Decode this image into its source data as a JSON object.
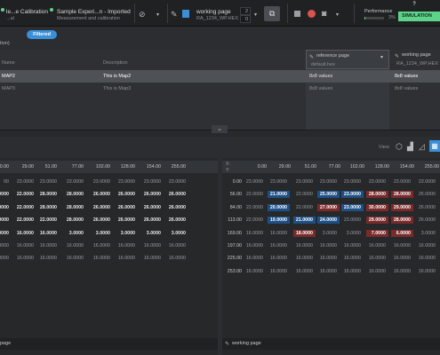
{
  "toolbar": {
    "project_title": "le...e Calibration",
    "project_sub": "...al",
    "experiment_title": "Sample Experi...n - Imported",
    "experiment_sub": "Measurement and calibration",
    "page_title": "working page",
    "page_sub": "RA_1234_WP.HEX",
    "stepper_top": "2",
    "stepper_bottom": "0",
    "performance_label": "Performance",
    "performance_value": "3%",
    "performance_fraction": 0.03,
    "mode_label": "SIMULATION",
    "help": "?"
  },
  "filter": {
    "chip": "Filtered",
    "truncated_label": "tion)"
  },
  "table": {
    "col_name": "Name",
    "col_description": "Description",
    "rows": [
      {
        "name": "MAP2",
        "description": "This is Map2",
        "ref": "8x8 values",
        "work": "8x8 values"
      },
      {
        "name": "MAP3",
        "description": "This is Map3",
        "ref": "8x8 values",
        "work": "8x8 values"
      }
    ]
  },
  "ref_column": {
    "label": "reference page",
    "file": "default.hex"
  },
  "work_column": {
    "label": "working page",
    "file": "RA_1234_WP.HEX"
  },
  "view": {
    "label": "View"
  },
  "left_map": {
    "x_headers": [
      "0.00",
      "29.00",
      "51.00",
      "77.00",
      "102.00",
      "128.00",
      "154.00",
      "255.00"
    ],
    "rows": [
      [
        "00",
        "23.0000",
        "23.0000",
        "23.0000",
        "23.0000",
        "23.0000",
        "23.0000",
        "23.0000"
      ],
      [
        "0000",
        "22.0000",
        "28.0000",
        "28.0000",
        "26.0000",
        "26.0000",
        "26.0000",
        "26.0000"
      ],
      [
        "0000",
        "22.0000",
        "28.0000",
        "28.0000",
        "26.0000",
        "26.0000",
        "26.0000",
        "26.0000"
      ],
      [
        "0000",
        "22.0000",
        "22.0000",
        "28.0000",
        "26.0000",
        "26.0000",
        "26.0000",
        "26.0000"
      ],
      [
        "0000",
        "16.0000",
        "16.0000",
        "3.0000",
        "3.0000",
        "3.0000",
        "3.0000",
        "3.0000"
      ],
      [
        "0000",
        "16.0000",
        "16.0000",
        "16.0000",
        "16.0000",
        "16.0000",
        "16.0000",
        "16.0000"
      ],
      [
        "0000",
        "16.0000",
        "16.0000",
        "16.0000",
        "16.0000",
        "16.0000",
        "16.0000",
        "16.0000"
      ]
    ],
    "footer": "page"
  },
  "right_map": {
    "corner_top": "X:",
    "corner_bottom": "Y:",
    "x_headers": [
      "0.00",
      "29.00",
      "51.00",
      "77.00",
      "102.00",
      "128.00",
      "154.00",
      "255.00"
    ],
    "y_headers": [
      "0.00",
      "56.00",
      "84.00",
      "113.00",
      "169.00",
      "197.00",
      "225.00",
      "253.00"
    ],
    "rows": [
      [
        "23.0000",
        "23.0000",
        "23.0000",
        "23.0000",
        "23.0000",
        "23.0000",
        "23.0000",
        "23.0000"
      ],
      [
        "22.0000",
        "21.0000",
        "22.0000",
        "25.0000",
        "23.0000",
        "28.0000",
        "28.0000",
        "26.0000"
      ],
      [
        "22.0000",
        "20.0000",
        "22.0000",
        "27.0000",
        "23.0000",
        "30.0000",
        "29.0000",
        "26.0000"
      ],
      [
        "22.0000",
        "19.0000",
        "21.0000",
        "24.0000",
        "23.0000",
        "29.0000",
        "28.0000",
        "26.0000"
      ],
      [
        "16.0000",
        "16.0000",
        "18.0000",
        "3.0000",
        "3.0000",
        "7.0000",
        "6.0000",
        "3.0000"
      ],
      [
        "16.0000",
        "16.0000",
        "16.0000",
        "16.0000",
        "16.0000",
        "16.0000",
        "16.0000",
        "16.0000"
      ],
      [
        "16.0000",
        "16.0000",
        "16.0000",
        "16.0000",
        "16.0000",
        "16.0000",
        "16.0000",
        "16.0000"
      ],
      [
        "16.0000",
        "16.0000",
        "16.0000",
        "16.0000",
        "16.0000",
        "16.0000",
        "16.0000",
        "16.0000"
      ]
    ],
    "footer": "working page"
  },
  "colors": {
    "accent_green": "#5fd38a",
    "chip_blue": "#3b8fd6",
    "decrease": "#1e4f86",
    "increase": "#7a2a2a"
  }
}
